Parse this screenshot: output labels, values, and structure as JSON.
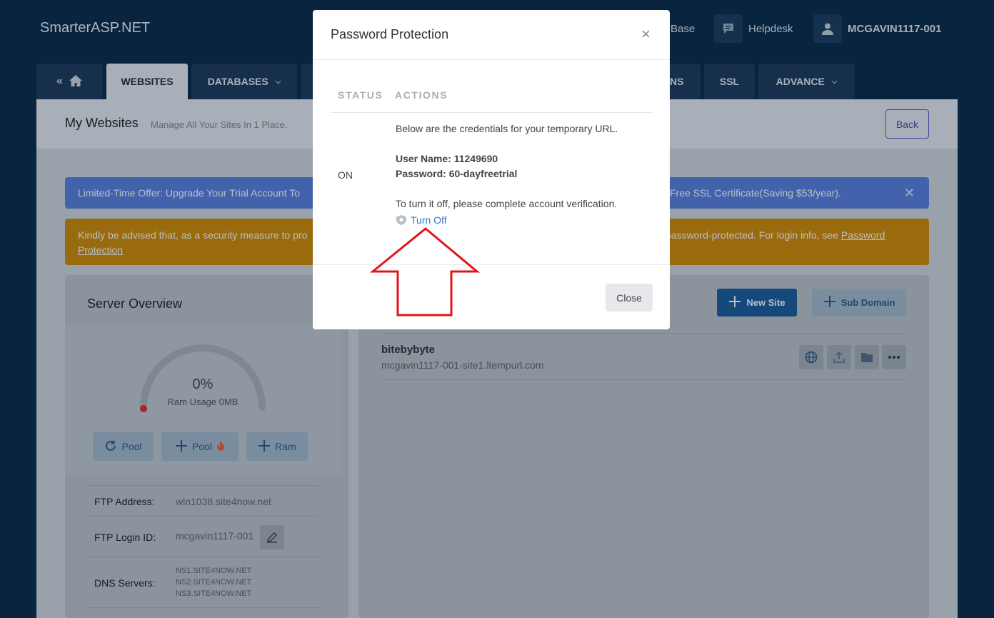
{
  "header": {
    "brand": "SmarterASP.NET",
    "knowledge_label": "Base",
    "helpdesk_label": "Helpdesk",
    "user_label": "MCGAVIN1117-001"
  },
  "tabs": {
    "websites": "WEBSITES",
    "databases": "DATABASES",
    "ns_fragment": "NS",
    "ssl": "SSL",
    "advance": "ADVANCE"
  },
  "page": {
    "title": "My Websites",
    "subtitle": "Manage All Your Sites In 1 Place.",
    "back_label": "Back"
  },
  "banners": {
    "offer_left": "Limited-Time Offer: Upgrade Your Trial Account To",
    "offer_right": "l Free SSL Certificate(Saving $53/year).",
    "notice_left": "Kindly be advised that, as a security measure to pro",
    "notice_right": "password-protected. For login info, see",
    "notice_link_1": "Password",
    "notice_link_2": "Protection",
    "close_symbol": "✕"
  },
  "server": {
    "title": "Server Overview",
    "ram_percent_text": "0%",
    "ram_label": "Ram Usage 0MB",
    "ram_fraction": 0,
    "pool_recycle_label": "Pool",
    "pool_add_label": "Pool",
    "ram_add_label": "Ram",
    "ftp_address_label": "FTP Address:",
    "ftp_address": "win1038.site4now.net",
    "ftp_login_label": "FTP Login ID:",
    "ftp_login": "mcgavin1117-001",
    "dns_label": "DNS Servers:",
    "dns": [
      "NS1.SITE4NOW.NET",
      "NS2.SITE4NOW.NET",
      "NS3.SITE4NOW.NET"
    ]
  },
  "sites": {
    "new_site_label": "New Site",
    "sub_domain_label": "Sub Domain",
    "items": [
      {
        "name": "bitebybyte",
        "url": "mcgavin1117-001-site1.ltempurl.com"
      }
    ]
  },
  "modal": {
    "title": "Password Protection",
    "close_symbol": "×",
    "col_status": "STATUS",
    "col_actions": "ACTIONS",
    "status_value": "ON",
    "intro": "Below are the credentials for your temporary URL.",
    "username_line": "User Name: 11249690",
    "password_line": "Password: 60-dayfreetrial",
    "turnoff_note": "To turn it off, please complete account verification.",
    "turnoff_link": "Turn Off",
    "close_button": "Close"
  },
  "colors": {
    "annotation_arrow": "#e3151b",
    "link": "#2f7abf",
    "primary_button": "#1d5d9c"
  }
}
